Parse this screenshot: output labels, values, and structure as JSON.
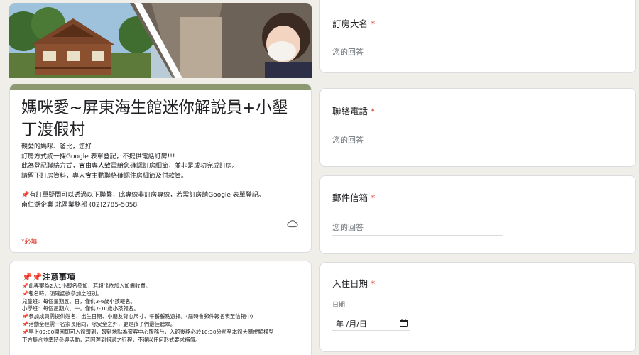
{
  "banner": {
    "image": "cabin-and-child-with-mask-photo"
  },
  "title_card": {
    "title": "媽咪愛~屏東海生館迷你解說員+小墾丁渡假村",
    "description_lines": [
      "親愛的媽咪、爸比，您好",
      "訂房方式統一採Google 表單登記，不提供電話訂房!!!",
      "此為登記聯絡方式，會由專人致電給您確認訂房細節，並非是成功完成訂房。",
      "請留下訂房資料，專人會主動聯絡確認住房細節及付款資。",
      "",
      "📌有訂單疑問可以透過以下聯繫，此專線非訂房專線，若需訂房請Google 表單登記。",
      "南仁湖企業 北區業務部 (02)2785-5058"
    ],
    "cloud_icon": "cloud-save-icon",
    "required_note": "*必填"
  },
  "notice_card": {
    "title": "📌📌注意事項",
    "lines": [
      "📌此專案為2大1小報名參加，若超出依加入加價收費。",
      "📌報名時，須確認欲參加之班別。",
      "兒童班：每個星期五、日，僅供3-6歲小孩報名。",
      "小學班：每個星期六、一，僅供7-10歲小孩報名。",
      "📌參加成員需提供姓名、出生日期、小朋友背心尺寸、午餐餐點選擇。(屆時會郵件報名表至信箱中)",
      "📌活動全程需一名家長陪同，除安全之外，更是孩子們最佳聽眾。",
      "📌早上09:00開園即可入館報到，報到地點為遊客中心服務台，入館後務必於10:30分前至本館大廳虎鯨模型",
      "下方集合並準時參與活動，若因遲到錯過之行程，不得以任何形式要求補償。"
    ]
  },
  "questions": {
    "name": {
      "label": "訂房大名",
      "required_mark": "*",
      "placeholder": "您的回答"
    },
    "phone": {
      "label": "聯絡電話",
      "required_mark": "*",
      "placeholder": "您的回答"
    },
    "email": {
      "label": "郵件信箱",
      "required_mark": "*",
      "placeholder": "您的回答"
    },
    "date": {
      "label": "入住日期",
      "required_mark": "*",
      "sublabel": "日期",
      "value": "年 /月/日",
      "icon": "calendar-icon"
    }
  },
  "colors": {
    "accent": "#8c9870",
    "required": "#d93025",
    "background": "#f0eee8"
  }
}
